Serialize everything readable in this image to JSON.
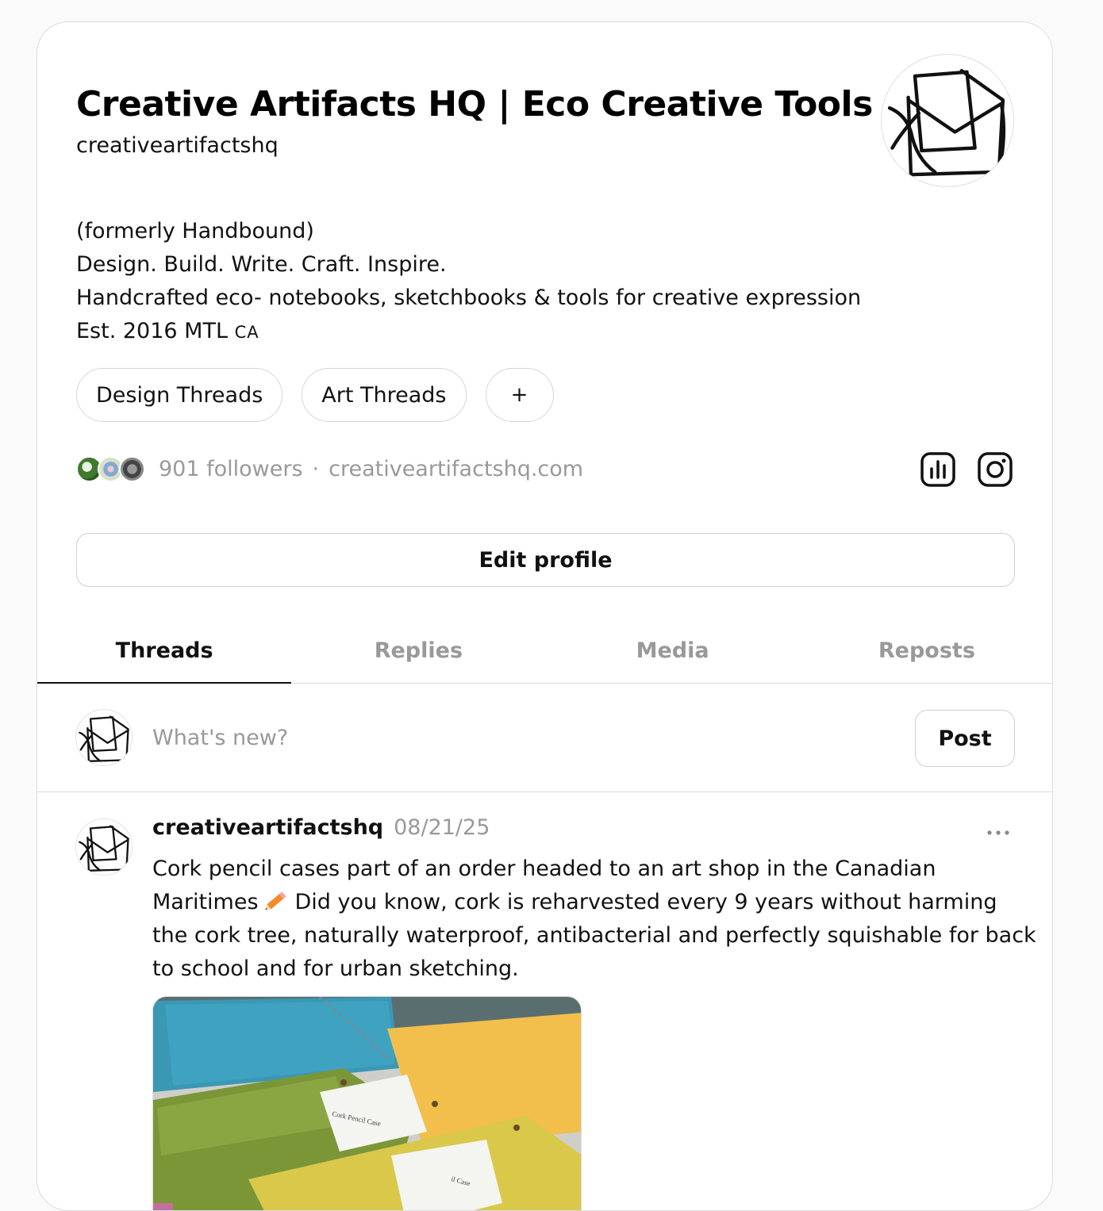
{
  "profile": {
    "display_name": "Creative Artifacts HQ | Eco Creative Tools",
    "username": "creativeartifactshq",
    "bio": [
      "(formerly Handbound)",
      "Design. Build. Write. Craft. Inspire.",
      "Handcrafted eco- notebooks, sketchbooks & tools for creative expression"
    ],
    "bio_last": "Est. 2016 MTL",
    "bio_last_flag": "CA",
    "tags": [
      "Design Threads",
      "Art Threads"
    ],
    "add_tag_label": "+",
    "followers": "901 followers",
    "separator": "·",
    "website": "creativeartifactshq.com",
    "edit_profile_label": "Edit profile"
  },
  "tabs": [
    {
      "label": "Threads",
      "active": true
    },
    {
      "label": "Replies",
      "active": false
    },
    {
      "label": "Media",
      "active": false
    },
    {
      "label": "Reposts",
      "active": false
    }
  ],
  "composer": {
    "placeholder": "What's new?",
    "post_label": "Post"
  },
  "thread": {
    "username": "creativeartifactshq",
    "date": "08/21/25",
    "lines": [
      "Cork pencil cases part of an order headed to an art shop in the Canadian",
      "Maritimes",
      "Did you know, cork is reharvested every 9 years without harming",
      "the cork tree, naturally waterproof, antibacterial and perfectly squishable for back",
      "to school and for urban sketching."
    ],
    "image_label": "Cork Pencil Case",
    "image_label_2": "il Case"
  },
  "icons": {
    "avatar": "envelope-sketch-icon",
    "insights": "bar-chart-icon",
    "instagram": "instagram-icon",
    "more": "more-horizontal-icon",
    "pencil": "pencil-emoji-icon"
  }
}
